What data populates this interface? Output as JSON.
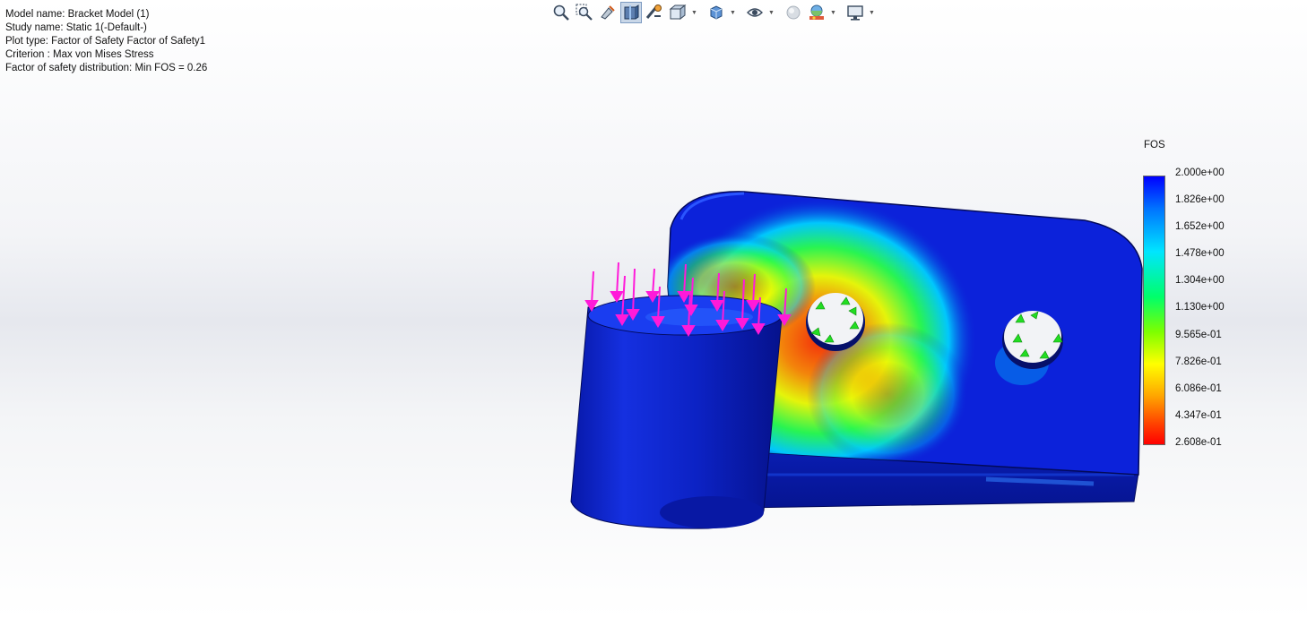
{
  "info": {
    "model_name": "Model name: Bracket Model (1)",
    "study_name": "Study name: Static 1(-Default-)",
    "plot_type": "Plot type: Factor of Safety Factor of Safety1",
    "criterion": "Criterion : Max von Mises Stress",
    "distribution": "Factor of safety distribution: Min FOS = 0.26"
  },
  "toolbar": {
    "icons": [
      "zoom-to-fit-icon",
      "zoom-to-area-icon",
      "previous-view-icon",
      "section-view-icon",
      "dynamic-annotation-icon",
      "view-orientation-icon",
      "display-style-icon",
      "hide-show-items-icon",
      "edit-appearance-icon",
      "apply-scene-icon",
      "view-settings-icon"
    ]
  },
  "legend": {
    "title": "FOS",
    "labels": [
      "2.000e+00",
      "1.826e+00",
      "1.652e+00",
      "1.478e+00",
      "1.304e+00",
      "1.130e+00",
      "9.565e-01",
      "7.826e-01",
      "6.086e-01",
      "4.347e-01",
      "2.608e-01"
    ],
    "colors": {
      "max": "#0000ff",
      "mid": "#00ff6a",
      "min": "#ff0000"
    }
  },
  "colors": {
    "model_base": "#0a1fd6",
    "load_arrows": "#ff1ad9",
    "fixtures": "#22dd22"
  }
}
